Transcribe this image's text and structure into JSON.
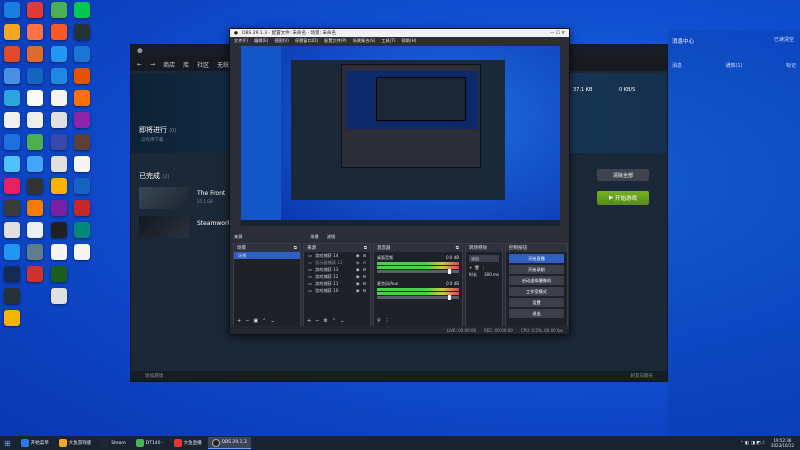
{
  "colors": {
    "desktop": "#0f4fd0",
    "steam_bg": "#1b2838",
    "obs_bg": "#2b2e38",
    "accent_green": "#75b022",
    "obs_highlight": "#2f5fc2"
  },
  "steam": {
    "nav_items": [
      "商店",
      "库",
      "社区",
      "无统"
    ],
    "upcoming_title": "即将进行",
    "upcoming_count": "(0)",
    "upcoming_sub": "没有待下载",
    "done_title": "已完成",
    "done_count": "(2)",
    "games": [
      {
        "name": "The Front",
        "size": "25.1 GB"
      },
      {
        "name": "Steamworks",
        "size": ""
      }
    ],
    "clear_all_button": "清除全部",
    "play_button": "开始游戏",
    "stats": [
      "37.1 KB",
      "0 KB/S"
    ],
    "footer_left": "添加游戏",
    "footer_right": "好友与聊天"
  },
  "obs": {
    "window_title": "OBS 29.1.3 - 配置文件: 未命名 - 场景: 未命名",
    "menu": [
      "文件(F)",
      "编辑(E)",
      "视图(V)",
      "停靠窗口(D)",
      "配置文件(P)",
      "场景集合(S)",
      "工具(T)",
      "帮助(H)"
    ],
    "tabs": [
      "来源",
      "场景",
      "滤镜"
    ],
    "scenes_header": "场景",
    "scenes": [
      "场景"
    ],
    "sources_header": "来源",
    "sources": [
      "游戏捕获 14",
      "显示器捕获 13",
      "游戏捕获 13",
      "游戏捕获 12",
      "游戏捕获 11",
      "游戏捕获 10"
    ],
    "mixer_header": "混音器",
    "mixer": [
      {
        "name": "桌面音频",
        "db": "0.0 dB"
      },
      {
        "name": "麦克风/Aux",
        "db": "0.0 dB"
      }
    ],
    "transition_header": "转场特效",
    "transition_type": "淡出",
    "transition_duration_label": "时长",
    "transition_duration": "300 ms",
    "controls_header": "控制按钮",
    "controls": [
      "开始直播",
      "开始录制",
      "启动虚拟摄像机",
      "工作室模式",
      "设置",
      "退出"
    ],
    "status": [
      "LIVE: 00:00:00",
      "REC: 00:00:00",
      "CPU: 0.5%, 60.00 fps"
    ]
  },
  "right_panel": {
    "title": "消息中心",
    "tabs": [
      "消息",
      "通知(1)",
      "标记"
    ],
    "top_right": "已读清空"
  },
  "taskbar": {
    "items": [
      "开始菜单",
      "大鱼游戏版",
      "Steam",
      "DT140 -",
      "大鱼直播",
      "OBS 29.1.3"
    ],
    "time": "19:52:36",
    "date": "2023/10/12"
  }
}
